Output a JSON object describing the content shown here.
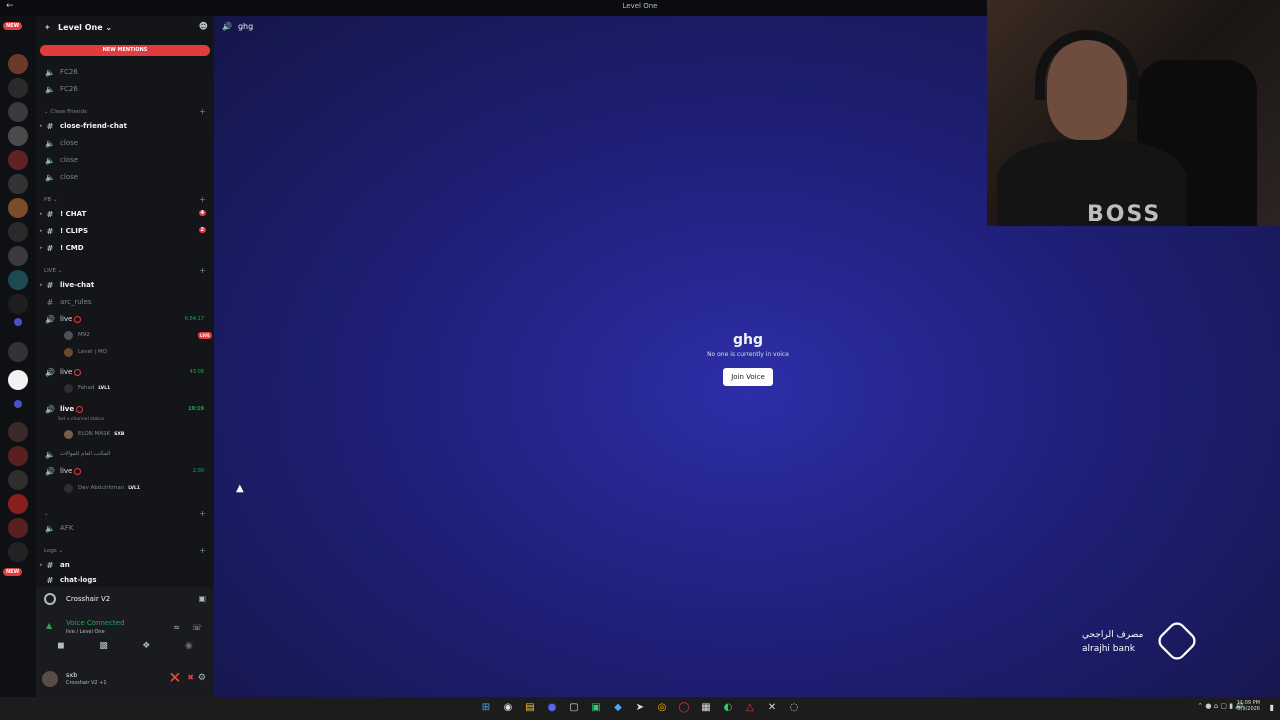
{
  "window": {
    "title": "Level One"
  },
  "guild": {
    "name": "Level One ⌄",
    "new_mentions": "NEW MENTIONS"
  },
  "channels": {
    "fc1": "FC26",
    "fc2": "FC26",
    "cat_close": "Close Friends",
    "close_friend_chat": "close-friend-chat",
    "close1": "close",
    "close2": "close",
    "close3": "close",
    "cat_pb": "PB",
    "chat": "! CHAT",
    "chat_count": "4",
    "clips": "! CLIPS",
    "clips_count": "2",
    "cmd": "! CMD",
    "cat_live": "LIVE",
    "live_chat": "live-chat",
    "arc_rules": "arc_rules",
    "live1": "live",
    "live1_timer": "6:54:17",
    "live1_user1": "M92",
    "live1_user1_badge": "LIVE",
    "live1_user2": "Level | MQ",
    "live2": "live",
    "live2_timer": "43:08",
    "live2_user1": "Fahad",
    "live2_user1_tag": "LVL1",
    "live3": "live",
    "live3_timer": "19:19",
    "live3_status": "Set a channel status",
    "live3_user1": "ELON MASK",
    "live3_user1_tag": "SXB",
    "office": "المكتب العام للموالات",
    "live4": "live",
    "live4_timer": "2:00",
    "live4_user1": "Dev Abdulrhman",
    "live4_user1_tag": "LVL1",
    "afk": "AFK",
    "cat_logs": "Logs",
    "an": "an",
    "chat_logs": "chat-logs"
  },
  "panel": {
    "activity": "Crosshair V2",
    "voice_connected": "Voice Connected",
    "voice_sub": "live / Level One",
    "username": "sxb",
    "user_status": "Crosshair V2 +1"
  },
  "main": {
    "channel_name": "ghg",
    "center_title": "ghg",
    "center_desc": "No one is currently in voice",
    "join_button": "Join Voice"
  },
  "overlay": {
    "bank_ar": "مصرف الراجحي",
    "bank_en": "alrajhi bank",
    "shirt": "BOSS"
  },
  "taskbar": {
    "time": "11:09 PM",
    "date": "3/9/2026"
  },
  "servers": {
    "new_top": "NEW",
    "new_bottom": "NEW"
  }
}
